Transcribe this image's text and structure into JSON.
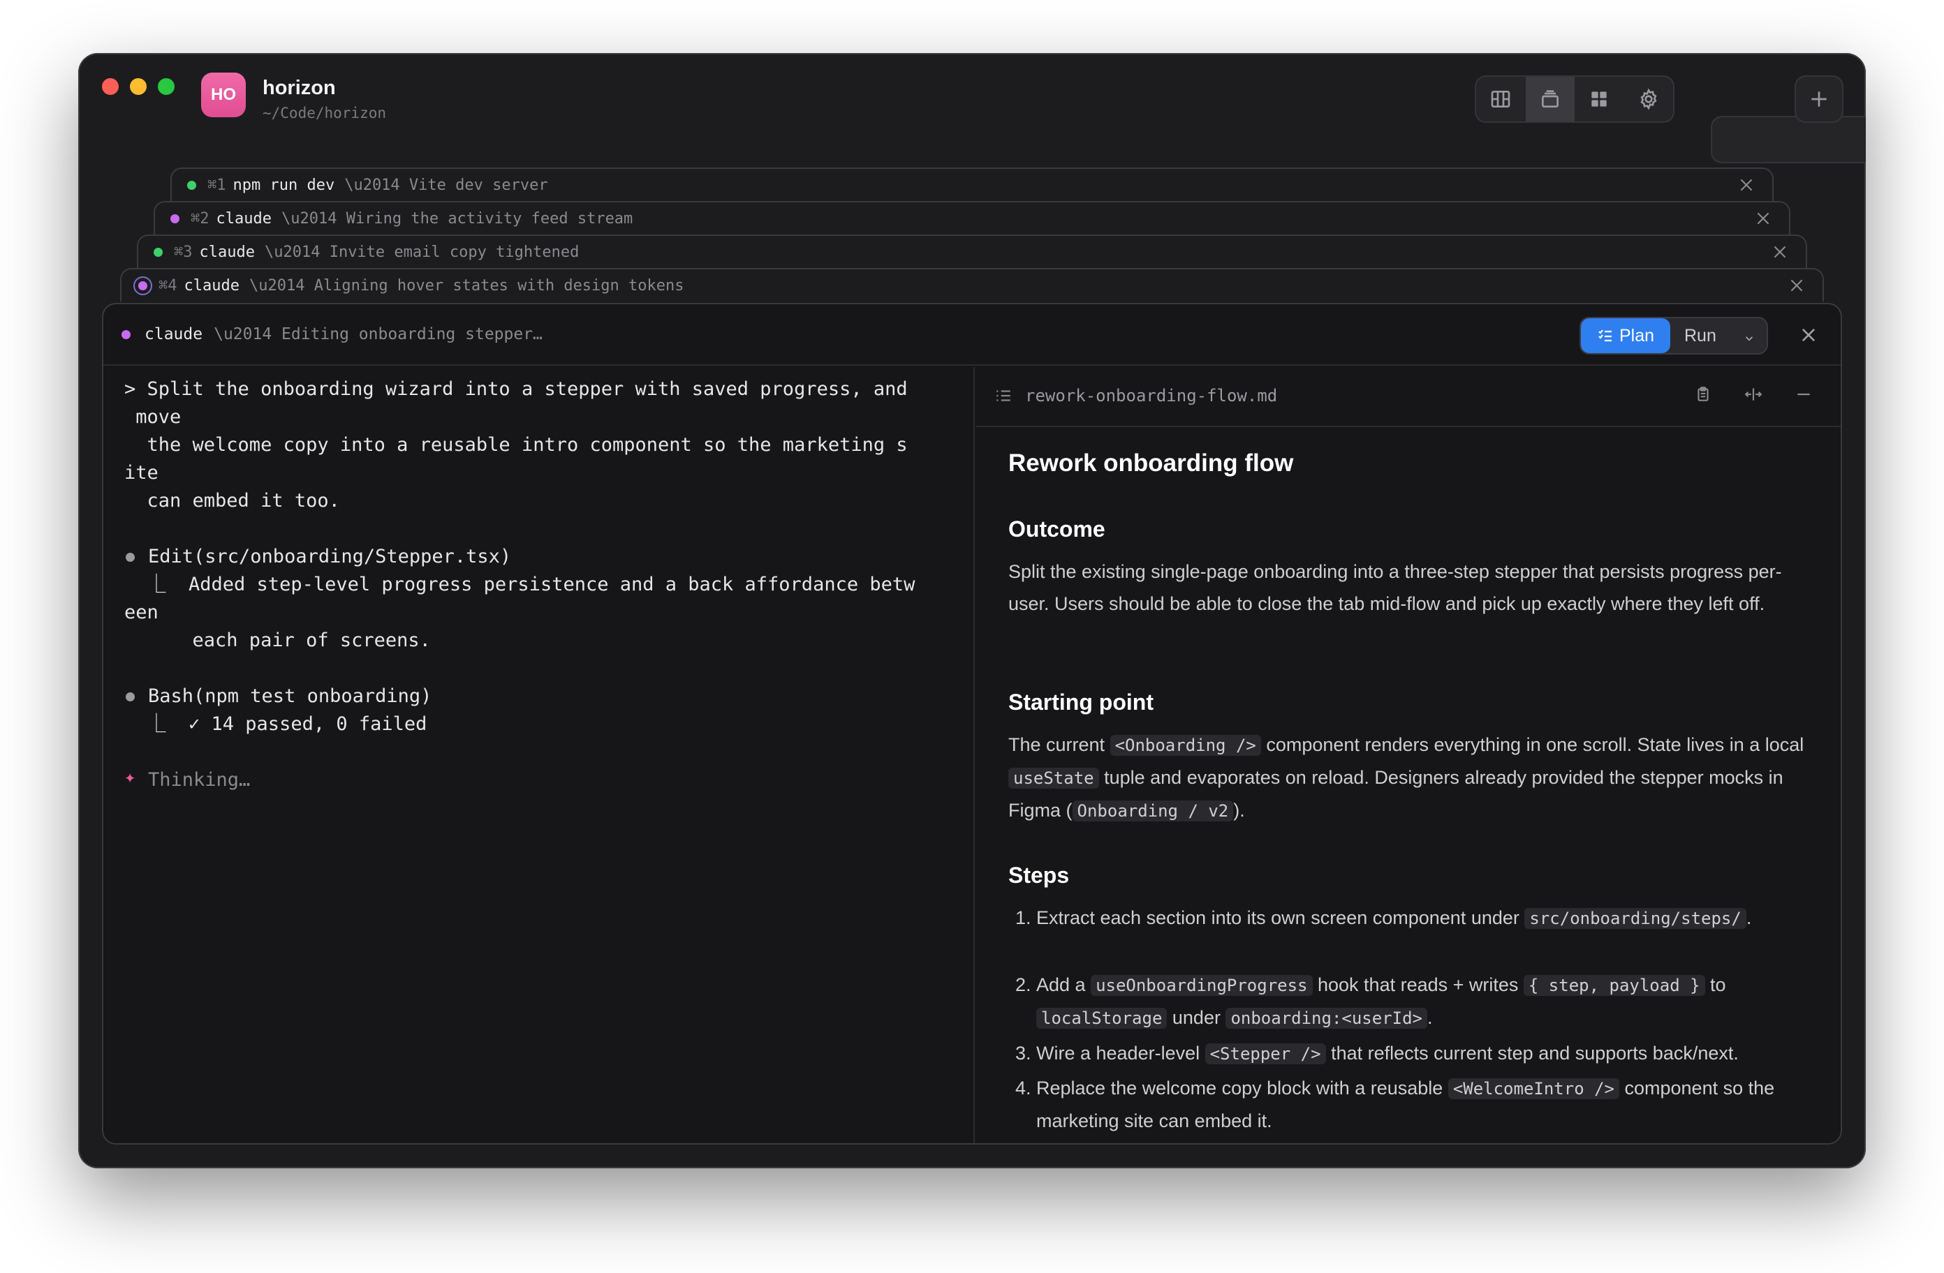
{
  "app": {
    "avatar": "HO",
    "name": "horizon",
    "path": "~/Code/horizon"
  },
  "toolbar": {
    "views": [
      "layout-board-icon",
      "stack-icon",
      "grid-icon",
      "gear-icon"
    ],
    "active_view": 1,
    "terminal_icon": "terminal-icon",
    "add_icon": "plus-icon"
  },
  "tabs": [
    {
      "status": "green",
      "shortcut": "⌘1",
      "command": "npm run dev",
      "desc": "\\u2014 Vite dev server"
    },
    {
      "status": "purple",
      "shortcut": "⌘2",
      "command": "claude",
      "desc": "\\u2014 Wiring the activity feed stream"
    },
    {
      "status": "green",
      "shortcut": "⌘3",
      "command": "claude",
      "desc": "\\u2014 Invite email copy tightened"
    },
    {
      "status": "purple",
      "shortcut": "⌘4",
      "command": "claude",
      "desc": "\\u2014 Aligning hover states with design tokens"
    }
  ],
  "panel": {
    "command": "claude",
    "desc": "\\u2014 Editing onboarding stepper…",
    "mode_plan": "Plan",
    "mode_run": "Run",
    "terminal": {
      "prompt_lines": [
        "> Split the onboarding wizard into a stepper with saved progress, and",
        " move",
        "  the welcome copy into a reusable intro component so the marketing s",
        "ite",
        "  can embed it too."
      ],
      "edit_call": "Edit(src/onboarding/Stepper.tsx)",
      "edit_result_lines": [
        "  ⎿  Added step-level progress persistence and a back affordance betw",
        "een",
        "      each pair of screens."
      ],
      "bash_call": "Bash(npm test onboarding)",
      "bash_result": "  ⎿  ✓ 14 passed, 0 failed",
      "thinking": "Thinking…"
    },
    "doc": {
      "filename": "rework-onboarding-flow.md",
      "title": "Rework onboarding flow",
      "outcome_heading": "Outcome",
      "outcome_text": "Split the existing single-page onboarding into a three-step stepper that persists progress per-user. Users should be able to close the tab mid-flow and pick up exactly where they left off.",
      "start_heading": "Starting point",
      "start_parts": {
        "a": "The current ",
        "code1": "<Onboarding />",
        "b": " component renders everything in one scroll. State lives in a local ",
        "code2": "useState",
        "c": " tuple and evaporates on reload. Designers already provided the stepper mocks in Figma (",
        "code3": "Onboarding / v2",
        "d": ")."
      },
      "steps_heading": "Steps",
      "steps": [
        {
          "n": "1.",
          "a": "Extract each section into its own screen component under ",
          "c1": "src/onboarding/steps/",
          "b": ".",
          "c2": "",
          "e": "",
          "c3": "",
          "f": ""
        },
        {
          "n": "2.",
          "a": "Add a ",
          "c1": "useOnboardingProgress",
          "b": " hook that reads + writes ",
          "c2": "{ step, payload }",
          "e": " to ",
          "c3": "localStorage",
          "f": " under ",
          "c4": "onboarding:<userId>",
          "g": "."
        },
        {
          "n": "3.",
          "a": "Wire a header-level ",
          "c1": "<Stepper />",
          "b": " that reflects current step and supports back/next."
        },
        {
          "n": "4.",
          "a": "Replace the welcome copy block with a reusable ",
          "c1": "<WelcomeIntro />",
          "b": " component so the marketing site can embed it."
        }
      ]
    }
  }
}
